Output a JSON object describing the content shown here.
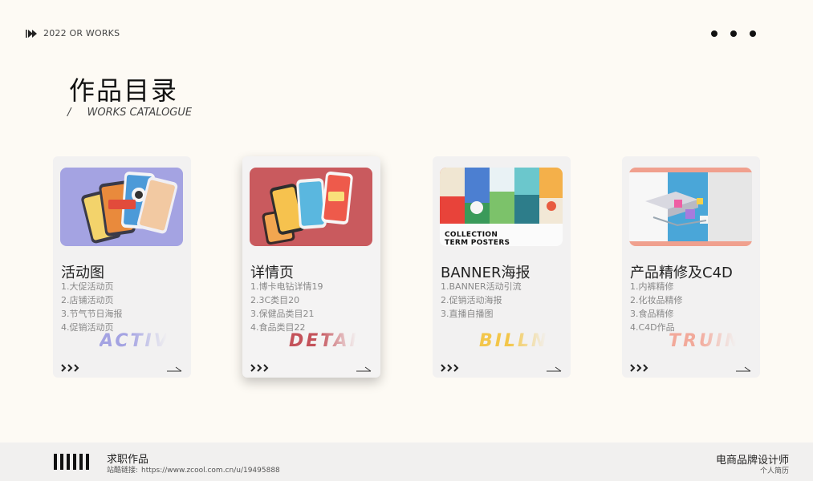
{
  "header": {
    "tag": "2022 OR WORKS",
    "title": "作品目录",
    "subtitle_slash": "/",
    "subtitle": "WORKS CATALOGUE"
  },
  "cards": [
    {
      "title": "活动图",
      "items": [
        "1.大促活动页",
        "2.店铺活动页",
        "3.节气节日海报",
        "4.促销活动页"
      ],
      "watermark": "ACTIVITY",
      "watermark_color": "#a4a3e2"
    },
    {
      "title": "详情页",
      "items": [
        "1.博卡电钻详情19",
        "2.3C类目20",
        "3.保健品类目21",
        "4.食品类目22"
      ],
      "watermark": "DETAIL",
      "watermark_color": "#c4525a"
    },
    {
      "title": "BANNER海报",
      "items": [
        "1.BANNER活动引流",
        "2.促销活动海报",
        "3.直播自播图"
      ],
      "watermark": "BILLNOTE",
      "watermark_color": "#f3c64a",
      "image_caption_1": "COLLECTION",
      "image_caption_2": "TERM POSTERS"
    },
    {
      "title": "产品精修及C4D",
      "items": [
        "1.内裤精修",
        "2.化妆品精修",
        "3.食品精修",
        "4.C4D作品"
      ],
      "watermark": "TRUING",
      "watermark_color": "#f2a99a"
    }
  ],
  "footer": {
    "title": "求职作品",
    "link_label": "站酷链接:",
    "link_url": "https://www.zcool.com.cn/u/19495888",
    "role": "电商品牌设计师",
    "resume": "个人简历"
  },
  "colors": {
    "background": "#fdfaf4",
    "footer": "#f1f0ef",
    "card": "#f2f1f1"
  }
}
